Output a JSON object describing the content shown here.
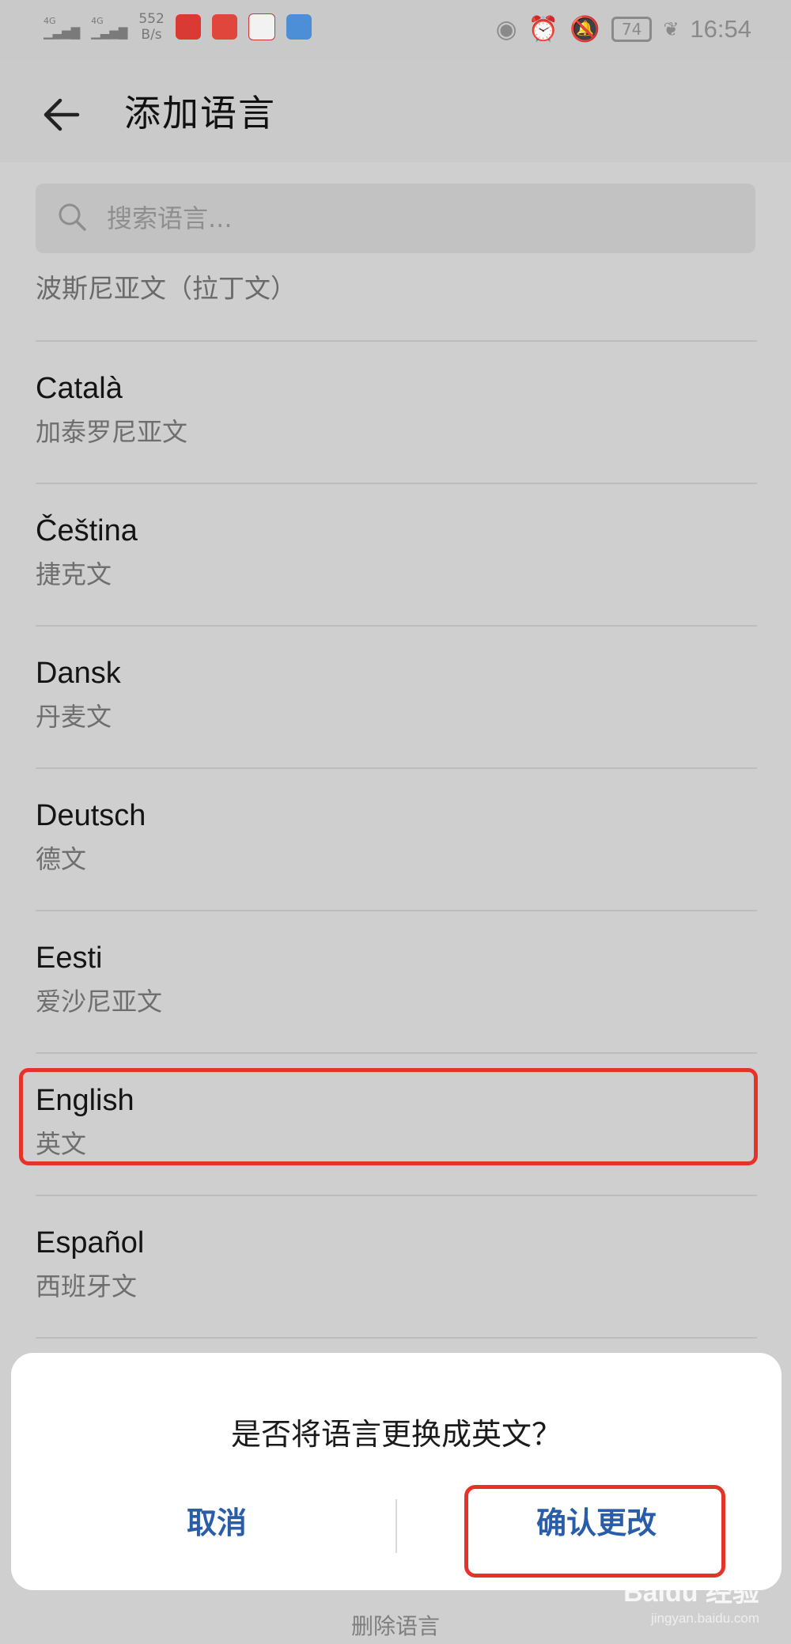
{
  "status_bar": {
    "signal1": "4G",
    "signal2": "4G",
    "speed_value": "552",
    "speed_unit": "B/s",
    "battery": "74",
    "time": "16:54"
  },
  "header": {
    "title": "添加语言"
  },
  "search": {
    "placeholder": "搜索语言..."
  },
  "list": {
    "partial_item": "波斯尼亚文（拉丁文）",
    "items": [
      {
        "name": "Català",
        "sub": "加泰罗尼亚文"
      },
      {
        "name": "Čeština",
        "sub": "捷克文"
      },
      {
        "name": "Dansk",
        "sub": "丹麦文"
      },
      {
        "name": "Deutsch",
        "sub": "德文"
      },
      {
        "name": "Eesti",
        "sub": "爱沙尼亚文"
      },
      {
        "name": "English",
        "sub": "英文"
      },
      {
        "name": "Español",
        "sub": "西班牙文"
      }
    ]
  },
  "bottom_bar": {
    "label": "删除语言"
  },
  "dialog": {
    "message": "是否将语言更换成英文？",
    "cancel_label": "取消",
    "confirm_label": "确认更改"
  },
  "watermark": {
    "brand": "Baidu 经验",
    "url": "jingyan.baidu.com"
  },
  "colors": {
    "accent": "#2a5da8",
    "highlight": "#e63329",
    "scrim": "#cfcfcf"
  }
}
